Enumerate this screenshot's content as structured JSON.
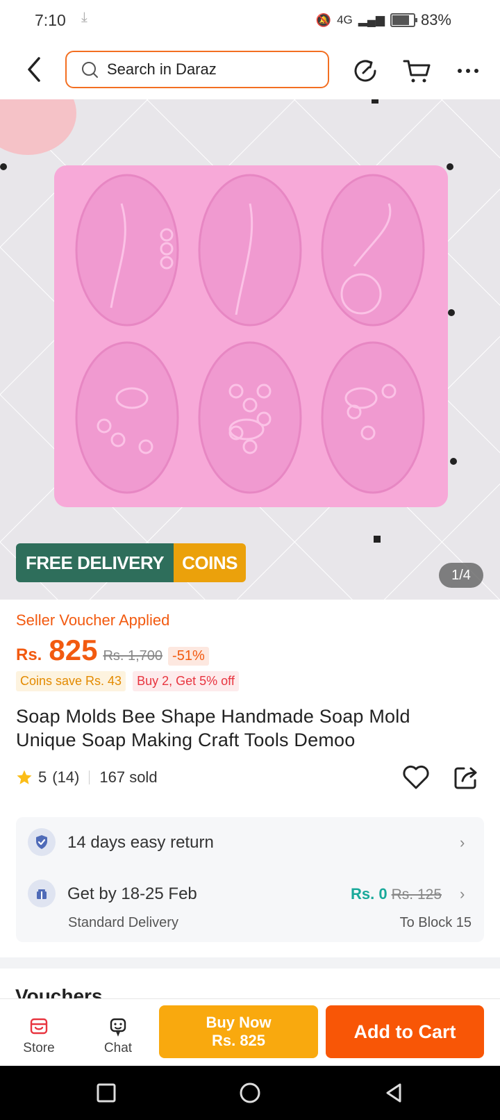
{
  "status_bar": {
    "time": "7:10",
    "network": "4G",
    "battery": "83%"
  },
  "search": {
    "placeholder": "Search in Daraz"
  },
  "gallery": {
    "badge_free": "FREE DELIVERY",
    "badge_coins": "COINS",
    "counter": "1/4"
  },
  "product": {
    "voucher_applied": "Seller Voucher Applied",
    "currency": "Rs.",
    "price": "825",
    "original_price": "Rs. 1,700",
    "discount": "-51%",
    "coins_tag": "Coins save Rs. 43",
    "promo_tag": "Buy 2, Get 5% off",
    "title": "Soap Molds Bee Shape Handmade Soap Mold Unique Soap Making Craft Tools Demoo",
    "rating": "5",
    "reviews": "(14)",
    "sold": "167 sold"
  },
  "service": {
    "return_text": "14 days easy return",
    "delivery_text": "Get by 18-25 Feb",
    "delivery_type": "Standard Delivery",
    "fee": "Rs. 0",
    "fee_original": "Rs. 125",
    "location": "To Block 15"
  },
  "vouchers_heading": "Vouchers",
  "bottom_bar": {
    "store_label": "Store",
    "chat_label": "Chat",
    "buy_now_label": "Buy Now",
    "buy_now_price": "Rs. 825",
    "add_to_cart_label": "Add to Cart"
  },
  "colors": {
    "accent": "#f85606",
    "buy_now": "#f9a90e",
    "free_delivery": "#2e6e5b",
    "coins": "#eba10b"
  }
}
